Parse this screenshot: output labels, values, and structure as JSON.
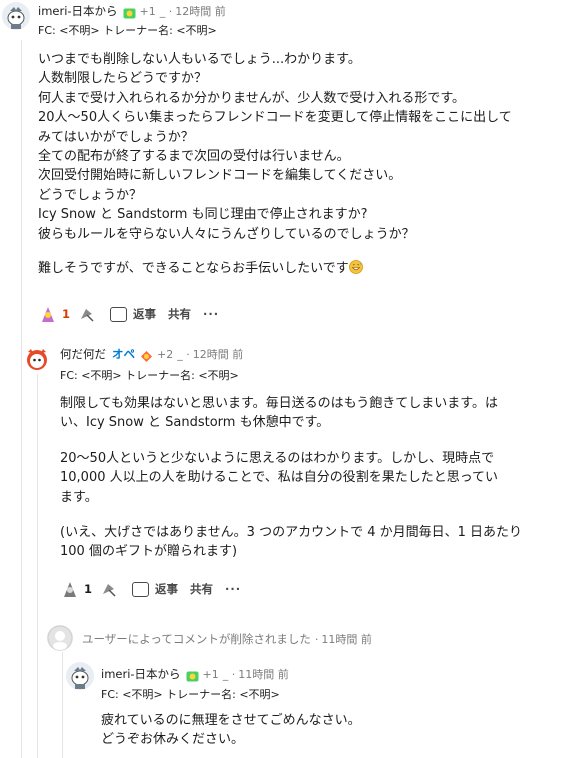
{
  "comments": [
    {
      "user": "imeri-日本から",
      "points": "+1",
      "separator": "_ ·",
      "time": "12時間 前",
      "flair": "FC: <不明> トレーナー名: <不明>",
      "lines": [
        "いつまでも削除しない人もいるでしょう...わかります。",
        "人数制限したらどうですか？",
        "何人まで受け入れられるか分かりませんが、少人数で受け入れる形です。",
        "20人～50人くらい集まったらフレンドコードを変更して停止情報をここに出して",
        "みてはいかがでしょうか？",
        "全ての配布が終了するまで次回の受付は行いません。",
        "次回受付開始時に新しいフレンドコードを編集してください。",
        "どうでしょうか？",
        "Icy Snow と Sandstorm も同じ理由で停止されますか?",
        "彼らもルールを守らない人々にうんざりしているのでしょうか？"
      ],
      "closing": "難しそうですが、できることならお手伝いしたいです",
      "score": "1",
      "reply": "返事",
      "share": "共有",
      "more": "···"
    },
    {
      "user": "何だ何だ",
      "mod_label": "オペ",
      "points": "+2",
      "separator": "_ ·",
      "time": "12時間 前",
      "flair": "FC: <不明> トレーナー名: <不明>",
      "p1": [
        "制限しても効果はないと思います。毎日送るのはもう飽きてしまいます。は",
        "い、Icy Snow と Sandstorm も休憩中です。"
      ],
      "p2": [
        "20～50人というと少ないように思えるのはわかります。しかし、現時点で",
        "10,000 人以上の人を助けることで、私は自分の役割を果たしたと思ってい",
        "ます。"
      ],
      "p3": [
        "(いえ、大げさではありません。3 つのアカウントで 4 か月間毎日、1 日あたり",
        "100 個のギフトが贈られます)"
      ],
      "score": "1",
      "reply": "返事",
      "share": "共有",
      "more": "···"
    },
    {
      "deleted_text": "ユーザーによってコメントが削除されました",
      "separator": "·",
      "time": "11時間 前"
    },
    {
      "user": "imeri-日本から",
      "points": "+1",
      "separator": "_ ·",
      "time": "11時間 前",
      "flair": "FC: <不明> トレーナー名: <不明>",
      "lines": [
        "疲れているのに無理をさせてごめんなさい。",
        "どうぞお休みください。"
      ]
    }
  ],
  "colors": {
    "score": "#d93a00",
    "mod": "#0079d3",
    "meta": "#7c7c7c",
    "thread": "#e5e5e5"
  }
}
